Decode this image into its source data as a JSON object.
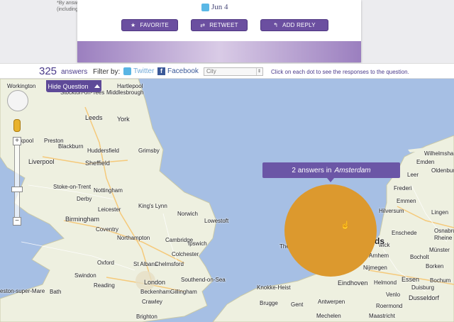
{
  "background": {
    "fine_print": "*By answ (including"
  },
  "card": {
    "date": "Jun 4",
    "buttons": {
      "favorite": "FAVORITE",
      "retweet": "RETWEET",
      "reply": "ADD REPLY"
    }
  },
  "filter_bar": {
    "count": "325",
    "count_label": "answers",
    "filter_by": "Filter by:",
    "twitter": "Twitter",
    "facebook": "Facebook",
    "city_select": "City",
    "hint": "Click on each dot to see the responses to the question."
  },
  "map": {
    "hide_question": "Hide Question",
    "tooltip_prefix": "2 answers in",
    "tooltip_city": "Amsterdam",
    "dot_color": "#dc992e",
    "accent": "#5e4a98",
    "places": {
      "workington": "Workington",
      "hartlepool": "Hartlepool",
      "stockton": "Stockton-on-Tees",
      "middlesbrough": "Middlesbrough",
      "leeds": "Leeds",
      "york": "York",
      "blackpool": "ckpool",
      "preston": "Preston",
      "blackburn": "Blackburn",
      "huddersfield": "Huddersfield",
      "grimsby": "Grimsby",
      "liverpool": "Liverpool",
      "sheffield": "Sheffield",
      "stoke": "Stoke-on-Trent",
      "nottingham": "Nottingham",
      "derby": "Derby",
      "leicester": "Leicester",
      "kingslynn": "King's Lynn",
      "norwich": "Norwich",
      "lowestoft": "Lowestoft",
      "birmingham": "Birmingham",
      "coventry": "Coventry",
      "northampton": "Northampton",
      "cambridge": "Cambridge",
      "ipswich": "Ipswich",
      "colchester": "Colchester",
      "oxford": "Oxford",
      "stalbans": "St Albans",
      "chelmsford": "Chelmsford",
      "southend": "Southend-on-Sea",
      "swindon": "Swindon",
      "london": "London",
      "reading": "Reading",
      "beckenham": "Beckenham",
      "gillingham": "Gillingham",
      "weston": "eston-super-Mare",
      "bath": "Bath",
      "crawley": "Crawley",
      "brighton": "Brighton",
      "wick": "wick",
      "frederi": "Frederi",
      "enschede": "Enschede",
      "emmen": "Emmen",
      "ds": "ds",
      "the": "The",
      "eindhoven": "Eindhoven",
      "knokke": "Knokke-Heist",
      "brugge": "Brugge",
      "essen": "Essen",
      "dusseldorf": "Dusseldorf",
      "wilhelmshaven": "Wilhelmsha",
      "oldenburg": "Oldenburg",
      "mechelen": "Mechelen",
      "helmond": "Helmond",
      "venlo": "Venlo",
      "leer": "Leer",
      "nijmegen": "Nijmegen",
      "hilversum": "Hilversum",
      "borken": "Borken",
      "bocholt": "Bocholt",
      "arnhem": "Arnhem",
      "lingen": "Lingen",
      "osnabruck": "Osnabruck",
      "muenster": "Münster",
      "duisburg": "Duisburg",
      "bochum": "Bochum",
      "ghent": "Gent",
      "antwerp": "Antwerpen",
      "roermond": "Roermond",
      "maastricht": "Maastricht",
      "rheine": "Rheine",
      "emden": "Emden"
    }
  }
}
